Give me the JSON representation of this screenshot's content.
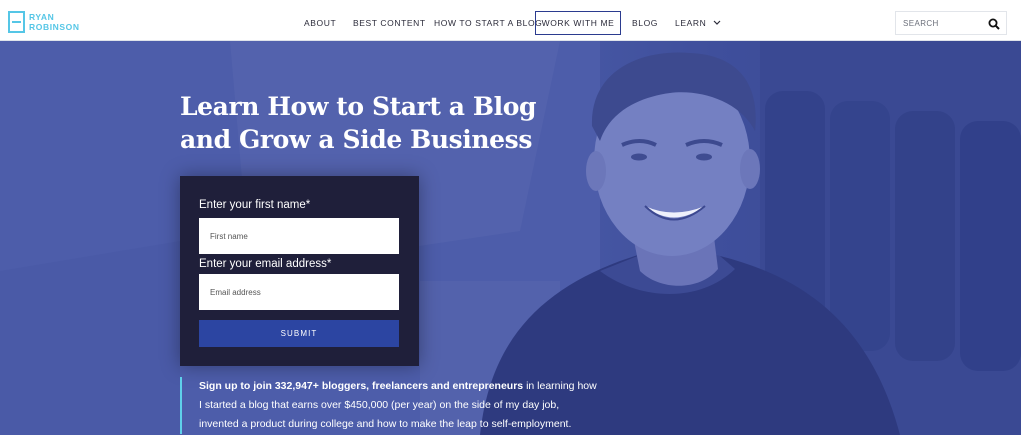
{
  "logo": {
    "line1": "RYAN",
    "line2": "ROBINSON"
  },
  "nav": {
    "about": "ABOUT",
    "best_content": "BEST CONTENT",
    "how_to": "HOW TO START A BLOG",
    "work": "WORK WITH ME",
    "blog": "BLOG",
    "learn": "LEARN"
  },
  "search": {
    "placeholder": "SEARCH"
  },
  "hero": {
    "headline_line1": "Learn How to Start a Blog",
    "headline_line2": "and Grow a Side Business"
  },
  "form": {
    "first_label": "Enter your first name*",
    "first_placeholder": "First name",
    "email_label": "Enter your email address*",
    "email_placeholder": "Email address",
    "submit": "SUBMIT"
  },
  "blurb": {
    "bold": "Sign up to join 332,947+ bloggers, freelancers and entrepreneurs",
    "rest": " in learning how I started a blog that earns over $450,000 (per year) on the side of my day job, invented a product during college and how to make the leap to self-employment."
  },
  "colors": {
    "accent_blue": "#2c45a2",
    "logo_cyan": "#55c6e6",
    "hero_overlay": "#4b5ba6",
    "form_bg": "#1f1f3a"
  }
}
